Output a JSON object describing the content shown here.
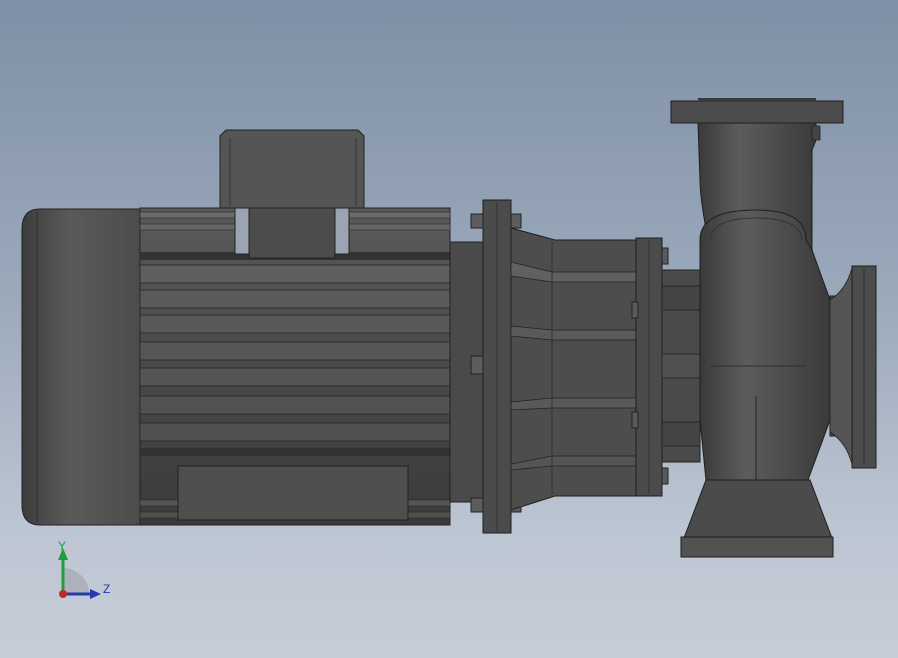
{
  "viewport": {
    "model_name": "",
    "background_colors": [
      "#7f90a6",
      "#c6cdd8"
    ],
    "part_color": "#4a4a4a"
  },
  "triad": {
    "y_label": "Y",
    "z_label": "Z",
    "y_color": "#1e9e3a",
    "z_color": "#2a3aa8",
    "x_color": "#c0282a"
  }
}
